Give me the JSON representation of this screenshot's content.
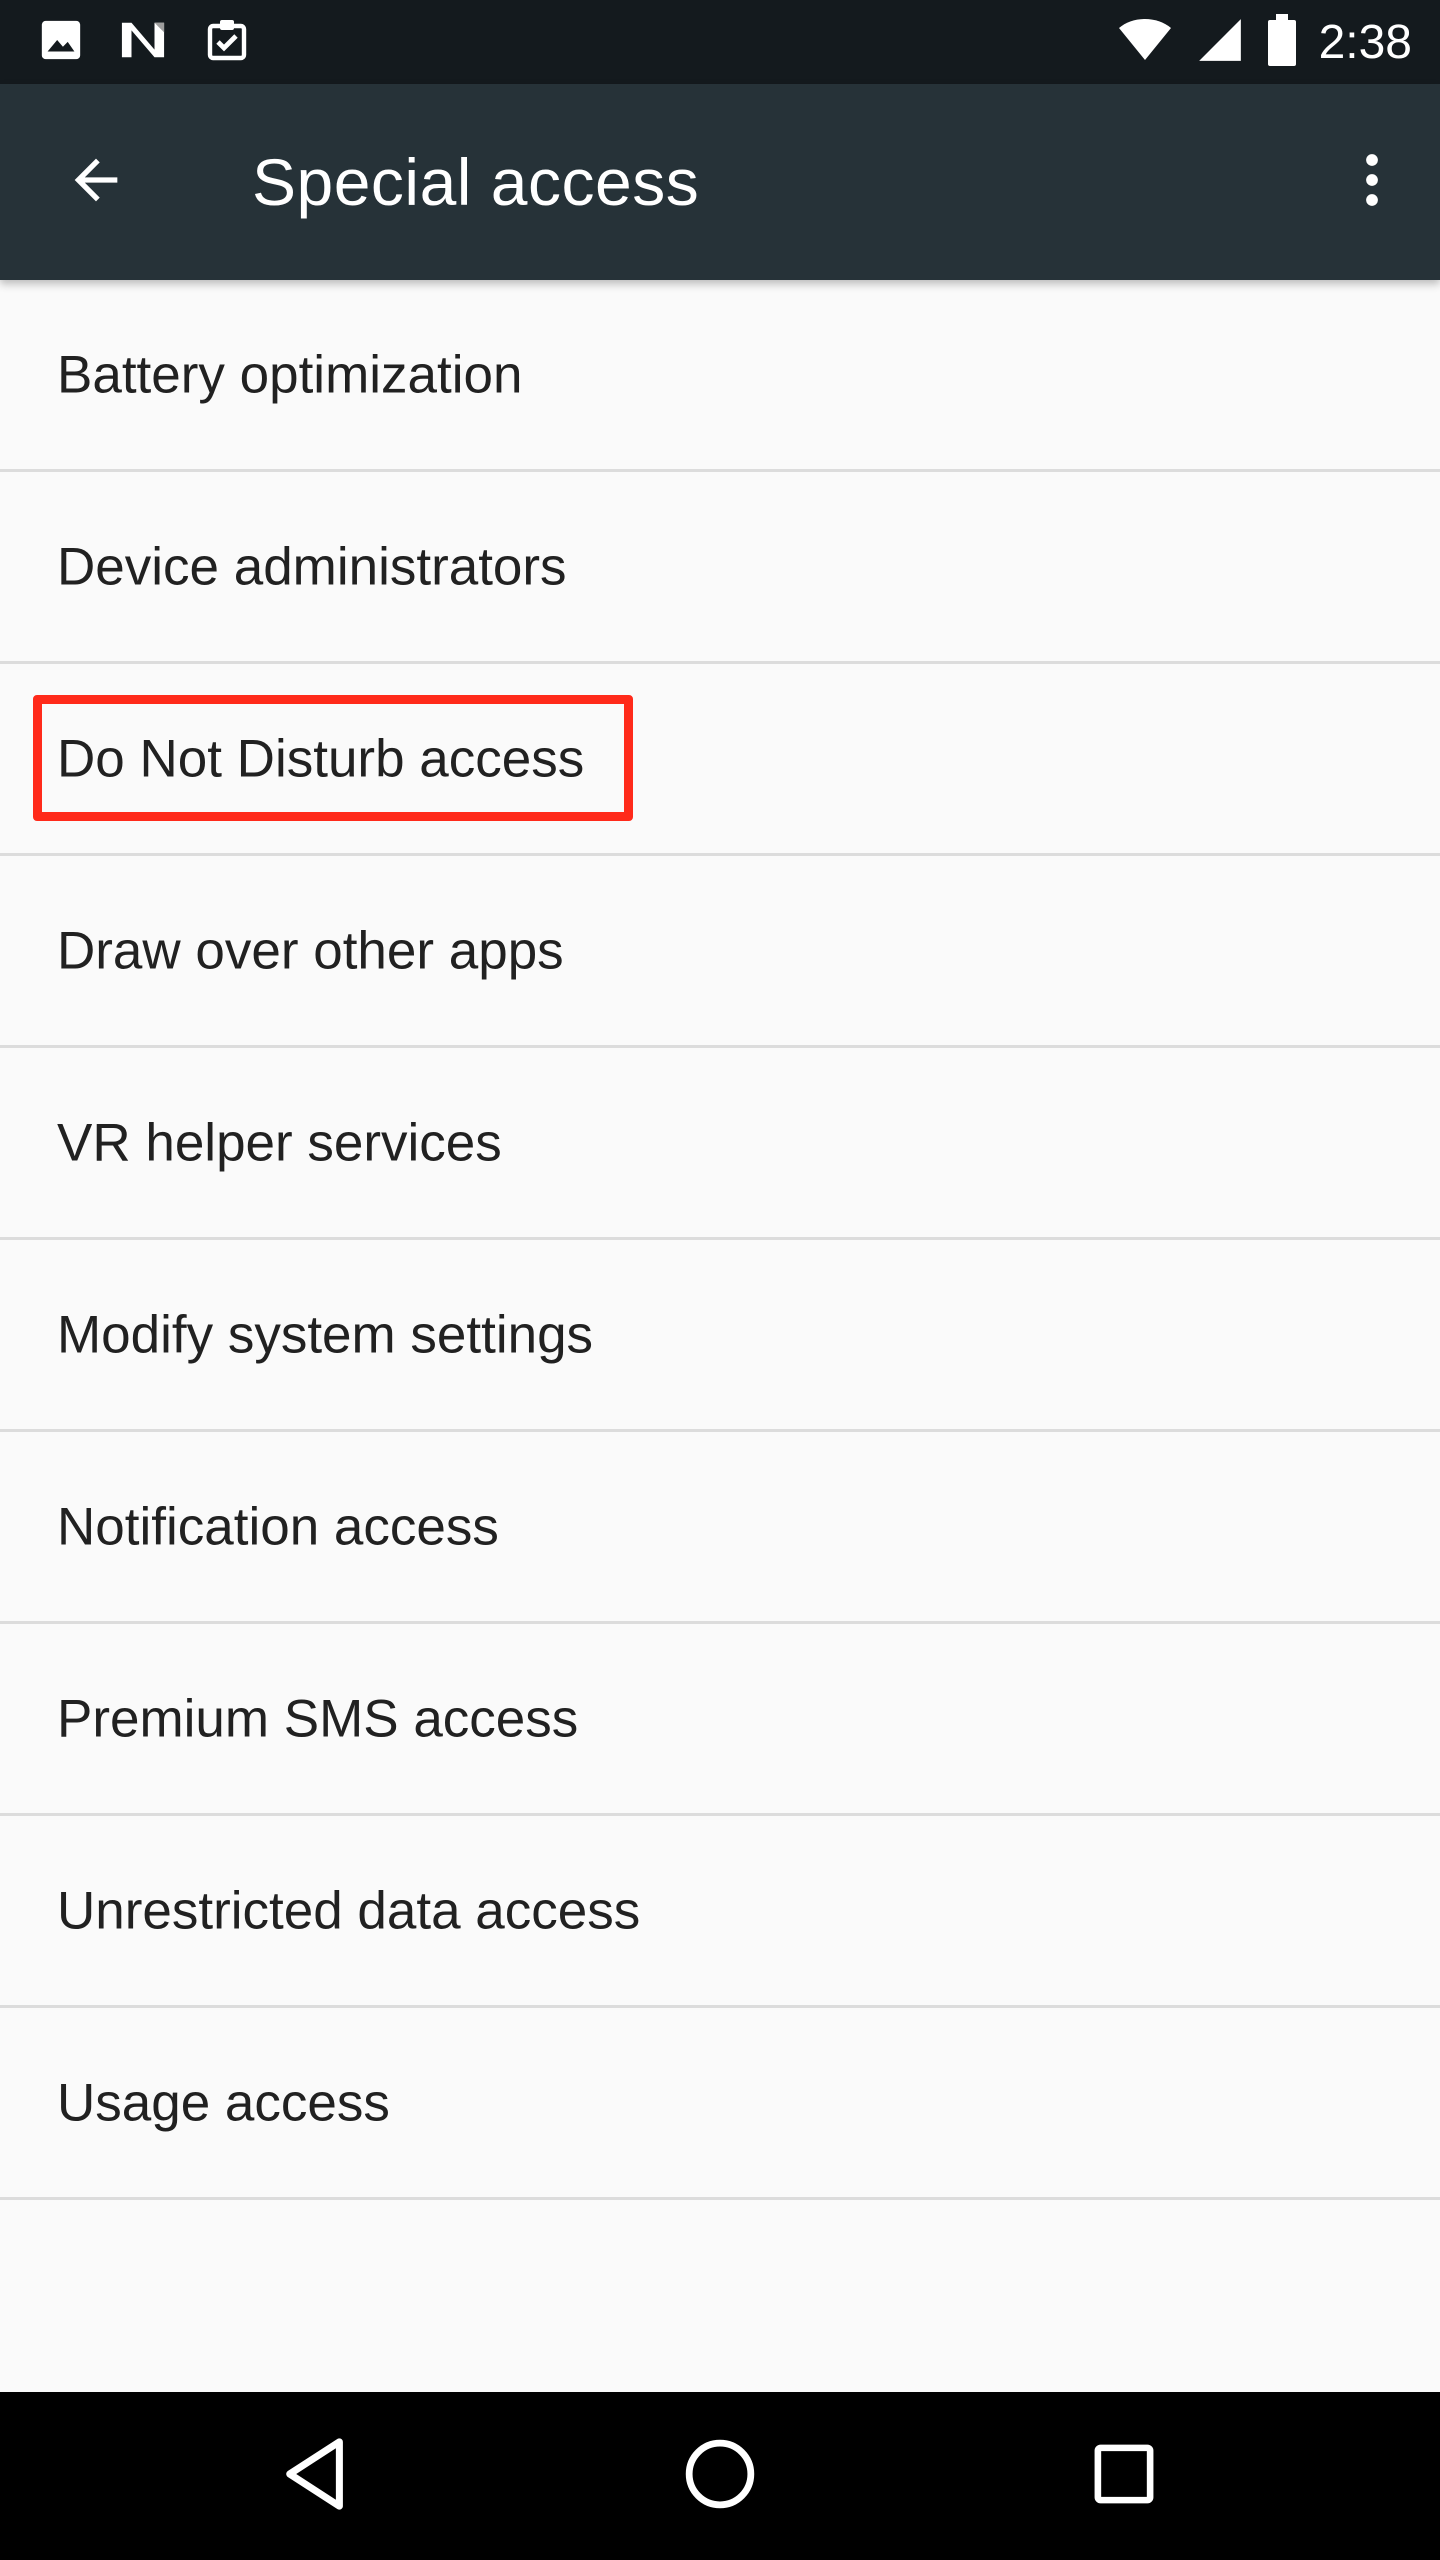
{
  "status_bar": {
    "time": "2:38",
    "left_icons": [
      "image-icon",
      "n-notification-icon",
      "clipboard-check-icon"
    ],
    "right_icons": [
      "wifi-icon",
      "cell-signal-icon",
      "battery-icon"
    ]
  },
  "app_bar": {
    "title": "Special access",
    "back_icon": "arrow-back-icon",
    "overflow_icon": "more-vert-icon"
  },
  "list": {
    "items": [
      {
        "label": "Battery optimization"
      },
      {
        "label": "Device administrators"
      },
      {
        "label": "Do Not Disturb access",
        "highlighted": true
      },
      {
        "label": "Draw over other apps"
      },
      {
        "label": "VR helper services"
      },
      {
        "label": "Modify system settings"
      },
      {
        "label": "Notification access"
      },
      {
        "label": "Premium SMS access"
      },
      {
        "label": "Unrestricted data access"
      },
      {
        "label": "Usage access"
      }
    ]
  },
  "nav_bar": {
    "icons": [
      "back-triangle-icon",
      "home-circle-icon",
      "recents-square-icon"
    ]
  },
  "colors": {
    "status_bar_bg": "#141a1e",
    "app_bar_bg": "#263238",
    "list_bg": "#fafafa",
    "divider": "#dcdcdc",
    "highlight": "#ff2a1a",
    "nav_bar_bg": "#000000"
  }
}
